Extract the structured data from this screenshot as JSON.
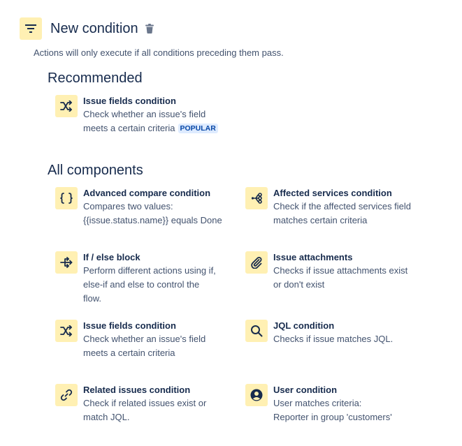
{
  "header": {
    "title": "New condition",
    "subtitle": "Actions will only execute if all conditions preceding them pass."
  },
  "recommended": {
    "title": "Recommended",
    "items": [
      {
        "title": "Issue fields condition",
        "desc1": "Check whether an issue's field",
        "desc2": "meets a certain criteria",
        "badge": "POPULAR",
        "icon": "shuffle-icon"
      }
    ]
  },
  "all": {
    "title": "All components",
    "items": [
      {
        "title": "Advanced compare condition",
        "desc": [
          "Compares two values:",
          "{{issue.status.name}} equals Done"
        ],
        "icon": "braces-icon"
      },
      {
        "title": "Affected services condition",
        "desc": [
          "Check if the affected services field",
          "matches certain criteria"
        ],
        "icon": "services-icon"
      },
      {
        "title": "If / else block",
        "desc": [
          "Perform different actions using if,",
          "else-if and else to control the",
          "flow."
        ],
        "icon": "branch-icon"
      },
      {
        "title": "Issue attachments",
        "desc": [
          "Checks if issue attachments exist",
          "or don't exist"
        ],
        "icon": "paperclip-icon"
      },
      {
        "title": "Issue fields condition",
        "desc": [
          "Check whether an issue's field",
          "meets a certain criteria"
        ],
        "icon": "shuffle-icon"
      },
      {
        "title": "JQL condition",
        "desc": [
          "Checks if issue matches JQL."
        ],
        "icon": "search-icon"
      },
      {
        "title": "Related issues condition",
        "desc": [
          "Check if related issues exist or",
          "match JQL."
        ],
        "icon": "link-icon"
      },
      {
        "title": "User condition",
        "desc": [
          "User matches criteria:",
          "Reporter in group 'customers'"
        ],
        "icon": "user-icon"
      }
    ]
  }
}
